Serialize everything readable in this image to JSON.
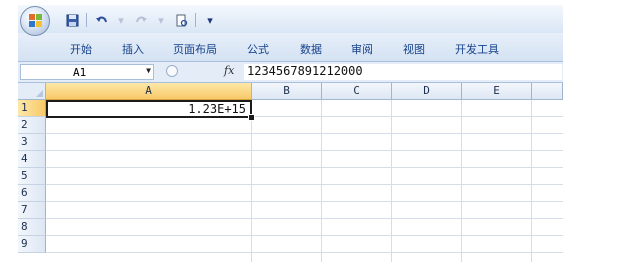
{
  "ribbon": {
    "tabs": [
      "开始",
      "插入",
      "页面布局",
      "公式",
      "数据",
      "审阅",
      "视图",
      "开发工具"
    ]
  },
  "quick_access": {
    "icons": [
      "save-icon",
      "undo-icon",
      "redo-icon",
      "print-preview-icon",
      "customize-icon"
    ]
  },
  "formula_bar": {
    "name_box": "A1",
    "fx_label": "fx",
    "content": "1234567891212000"
  },
  "grid": {
    "columns": [
      "A",
      "B",
      "C",
      "D",
      "E"
    ],
    "rows": [
      "1",
      "2",
      "3",
      "4",
      "5",
      "6",
      "7",
      "8",
      "9"
    ],
    "cells": {
      "A1": "1.23E+15"
    },
    "active_cell": "A1"
  },
  "colors": {
    "active_header": "#f8c969",
    "ribbon_text": "#15428b",
    "grid_line": "#d4dde8"
  }
}
